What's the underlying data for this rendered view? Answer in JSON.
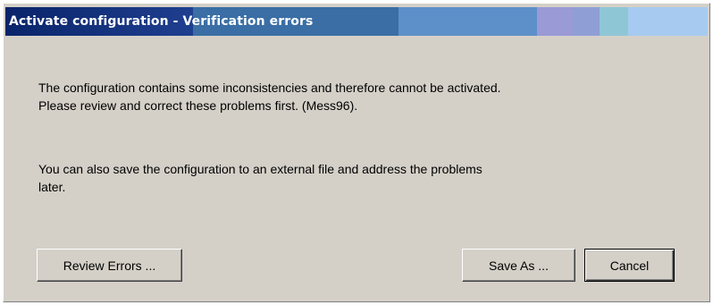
{
  "dialog": {
    "title": "Activate configuration - Verification errors",
    "title_gradient": [
      "#0a246a",
      "#3a6ea5",
      "#4f8ad6",
      "#6e95cf",
      "#6a8fd0",
      "#9a9ad6",
      "#8fbfd6",
      "#a6caf0"
    ]
  },
  "message": {
    "line1": "The configuration contains some inconsistencies and therefore cannot be activated.",
    "line2": "Please review and correct these problems first. (Mess96).",
    "line3": "You can also save the configuration to an external file and address the problems",
    "line4": "later."
  },
  "buttons": {
    "review_label": "Review Errors ...",
    "save_as_label": "Save As ...",
    "cancel_label": "Cancel"
  }
}
